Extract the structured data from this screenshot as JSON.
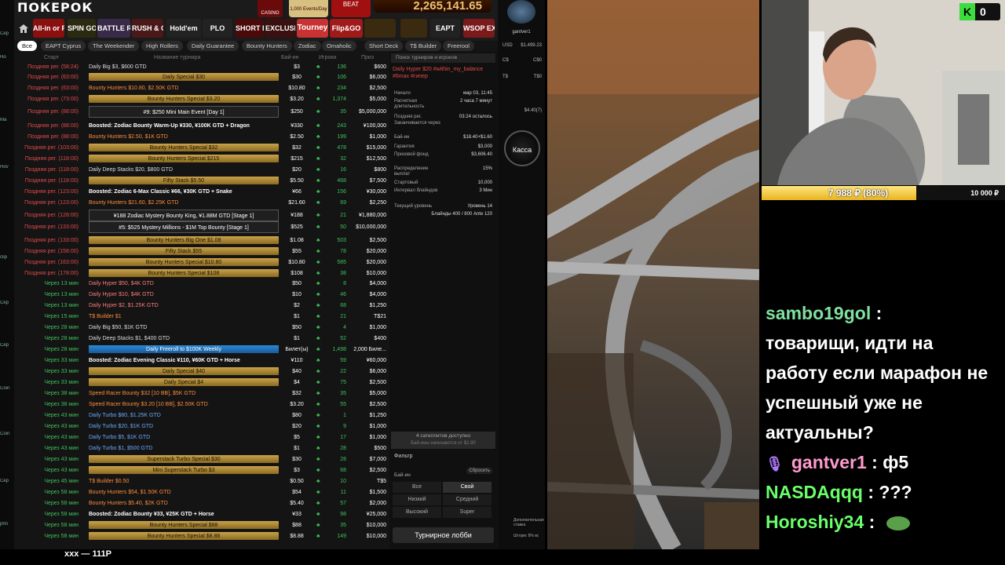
{
  "left_strip": [
    "Cер",
    "Ho",
    "Ma",
    "Hov",
    "clip",
    "Cер",
    "Cер",
    "Coin",
    "Coin",
    "Cер",
    "phn"
  ],
  "client": {
    "logo": "ПОКЕРОК",
    "promos": [
      "CASINO",
      "1,000 Events/Day",
      "BEAT"
    ],
    "jackpot": "2,265,141.65",
    "game_tabs": [
      "All-in or Fold",
      "SPIN GOLD",
      "BATTLE ROYALE",
      "RUSH & CASH",
      "Hold'em",
      "PLO",
      "SHORT DECK",
      "EXCLUSIVE",
      "Tourney",
      "Flip&GO",
      "",
      "",
      "EAPT",
      "WSOP EXPRESS"
    ],
    "filters": [
      "Все",
      "EAPT Cyprus",
      "The Weekender",
      "High Rollers",
      "Daily Guarantee",
      "Bounty Hunters",
      "Zodiac",
      "Omaholic",
      "Short Deck",
      "T$ Builder",
      "Freerool"
    ],
    "columns": {
      "start": "Старт",
      "name": "Название турнира",
      "buyin": "Бай-ин",
      "players": "Игроки",
      "prize": "Приз"
    },
    "rows": [
      {
        "s": "Поздняя рег. (58:24)",
        "n": "Daily Big $3, $600 GTD",
        "b": "$3",
        "p": "136",
        "z": "$600",
        "t": ""
      },
      {
        "s": "Поздняя рег. (63:00)",
        "n": "Daily Special $30",
        "b": "$30",
        "p": "106",
        "z": "$6,000",
        "t": "gold"
      },
      {
        "s": "Поздняя рег. (63:00)",
        "n": "Bounty Hunters $10.80, $2.50K GTD",
        "b": "$10.80",
        "p": "234",
        "z": "$2,500",
        "t": "bh"
      },
      {
        "s": "Поздняя рег. (73:00)",
        "n": "Bounty Hunters Special $3.20",
        "b": "$3.20",
        "p": "1,374",
        "z": "$5,000",
        "t": "gold"
      },
      {
        "s": "Поздняя рег. (88:00)",
        "n": "#9: $250 Mini Main Event [Day 1]",
        "b": "$250",
        "p": "35",
        "z": "$5,000,000",
        "t": "big"
      },
      {
        "s": "Поздняя рег. (88:00)",
        "n": "Boosted: Zodiac Bounty Warm-Up ¥330, ¥100K GTD + Dragon",
        "b": "¥330",
        "p": "243",
        "z": "¥100,000",
        "t": "white"
      },
      {
        "s": "Поздняя рег. (88:00)",
        "n": "Bounty Hunters $2.50, $1K GTD",
        "b": "$2.50",
        "p": "199",
        "z": "$1,000",
        "t": "bh"
      },
      {
        "s": "Поздняя рег. (103:00)",
        "n": "Bounty Hunters Special $32",
        "b": "$32",
        "p": "478",
        "z": "$15,000",
        "t": "gold"
      },
      {
        "s": "Поздняя рег. (118:00)",
        "n": "Bounty Hunters Special $215",
        "b": "$215",
        "p": "32",
        "z": "$12,500",
        "t": "gold"
      },
      {
        "s": "Поздняя рег. (118:00)",
        "n": "Daily Deep Stacks $20, $800 GTD",
        "b": "$20",
        "p": "16",
        "z": "$800",
        "t": ""
      },
      {
        "s": "Поздняя рег. (118:00)",
        "n": "Fifty Stack $5.50",
        "b": "$5.50",
        "p": "468",
        "z": "$7,500",
        "t": "gold"
      },
      {
        "s": "Поздняя рег. (123:00)",
        "n": "Boosted: Zodiac 6-Max Classic ¥66, ¥30K GTD + Snake",
        "b": "¥66",
        "p": "156",
        "z": "¥30,000",
        "t": "white"
      },
      {
        "s": "Поздняя рег. (123:00)",
        "n": "Bounty Hunters $21.60, $2.25K GTD",
        "b": "$21.60",
        "p": "69",
        "z": "$2,250",
        "t": "bh"
      },
      {
        "s": "Поздняя рег. (128:00)",
        "n": "¥188 Zodiac Mystery Bounty King, ¥1.88M GTD [Stage 1]",
        "b": "¥188",
        "p": "21",
        "z": "¥1,880,000",
        "t": "big"
      },
      {
        "s": "Поздняя рег. (133:00)",
        "n": "#5: $525 Mystery Millions - $1M Top Bounty [Stage 1]",
        "b": "$525",
        "p": "50",
        "z": "$10,000,000",
        "t": "big"
      },
      {
        "s": "Поздняя рег. (133:00)",
        "n": "Bounty Hunters Big One $1.08",
        "b": "$1.08",
        "p": "503",
        "z": "$2,500",
        "t": "gold"
      },
      {
        "s": "Поздняя рег. (158:00)",
        "n": "Fifty Stack $55",
        "b": "$55",
        "p": "78",
        "z": "$20,000",
        "t": "gold"
      },
      {
        "s": "Поздняя рег. (163:00)",
        "n": "Bounty Hunters Special $10.80",
        "b": "$10.80",
        "p": "585",
        "z": "$20,000",
        "t": "gold"
      },
      {
        "s": "Поздняя рег. (178:00)",
        "n": "Bounty Hunters Special $108",
        "b": "$108",
        "p": "38",
        "z": "$10,000",
        "t": "gold"
      },
      {
        "s": "Через 13 мин",
        "n": "Daily Hyper $50, $4K GTD",
        "b": "$50",
        "p": "8",
        "z": "$4,000",
        "t": "hyper"
      },
      {
        "s": "Через 13 мин",
        "n": "Daily Hyper $10, $4K GTD",
        "b": "$10",
        "p": "46",
        "z": "$4,000",
        "t": "hyper"
      },
      {
        "s": "Через 13 мин",
        "n": "Daily Hyper $2, $1.25K GTD",
        "b": "$2",
        "p": "68",
        "z": "$1,250",
        "t": "hyper"
      },
      {
        "s": "Через 15 мин",
        "n": "T$ Builder $1",
        "b": "$1",
        "p": "21",
        "z": "T$21",
        "t": "bh"
      },
      {
        "s": "Через 28 мин",
        "n": "Daily Big $50, $1K GTD",
        "b": "$50",
        "p": "4",
        "z": "$1,000",
        "t": ""
      },
      {
        "s": "Через 28 мин",
        "n": "Daily Deep Stacks $1, $400 GTD",
        "b": "$1",
        "p": "52",
        "z": "$400",
        "t": ""
      },
      {
        "s": "Через 28 мин",
        "n": "Daily Freeroll to $100K Weekly",
        "b": "Билет(ы)",
        "p": "1,498",
        "z": "2,000 Биле...",
        "t": "blue"
      },
      {
        "s": "Через 33 мин",
        "n": "Boosted: Zodiac Evening Classic ¥110, ¥60K GTD + Horse",
        "b": "¥110",
        "p": "59",
        "z": "¥60,000",
        "t": "white"
      },
      {
        "s": "Через 33 мин",
        "n": "Daily Special $40",
        "b": "$40",
        "p": "22",
        "z": "$6,000",
        "t": "gold"
      },
      {
        "s": "Через 33 мин",
        "n": "Daily Special $4",
        "b": "$4",
        "p": "75",
        "z": "$2,500",
        "t": "gold"
      },
      {
        "s": "Через 38 мин",
        "n": "Speed Racer Bounty $32 [10 BB], $5K GTD",
        "b": "$32",
        "p": "35",
        "z": "$5,000",
        "t": "bh"
      },
      {
        "s": "Через 38 мин",
        "n": "Speed Racer Bounty $3.20 [10 BB], $2.50K GTD",
        "b": "$3.20",
        "p": "55",
        "z": "$2,500",
        "t": "bh"
      },
      {
        "s": "Через 43 мин",
        "n": "Daily Turbo $80, $1.25K GTD",
        "b": "$80",
        "p": "1",
        "z": "$1,250",
        "t": "turbo"
      },
      {
        "s": "Через 43 мин",
        "n": "Daily Turbo $20, $1K GTD",
        "b": "$20",
        "p": "9",
        "z": "$1,000",
        "t": "turbo"
      },
      {
        "s": "Через 43 мин",
        "n": "Daily Turbo $5, $1K GTD",
        "b": "$5",
        "p": "17",
        "z": "$1,000",
        "t": "turbo"
      },
      {
        "s": "Через 43 мин",
        "n": "Daily Turbo $1, $500 GTD",
        "b": "$1",
        "p": "28",
        "z": "$500",
        "t": "turbo"
      },
      {
        "s": "Через 43 мин",
        "n": "Superstack Turbo Special $30",
        "b": "$30",
        "p": "28",
        "z": "$7,000",
        "t": "gold"
      },
      {
        "s": "Через 43 мин",
        "n": "Mini Superstack Turbo $3",
        "b": "$3",
        "p": "68",
        "z": "$2,500",
        "t": "gold"
      },
      {
        "s": "Через 45 мин",
        "n": "T$ Builder $0.50",
        "b": "$0.50",
        "p": "10",
        "z": "T$5",
        "t": "bh"
      },
      {
        "s": "Через 58 мин",
        "n": "Bounty Hunters $54, $1.50K GTD",
        "b": "$54",
        "p": "11",
        "z": "$1,500",
        "t": "bh"
      },
      {
        "s": "Через 58 мин",
        "n": "Bounty Hunters $5.40, $2K GTD",
        "b": "$5.40",
        "p": "57",
        "z": "$2,000",
        "t": "bh"
      },
      {
        "s": "Через 58 мин",
        "n": "Boosted: Zodiac Bounty ¥33, ¥25K GTD + Horse",
        "b": "¥33",
        "p": "98",
        "z": "¥25,000",
        "t": "white"
      },
      {
        "s": "Через 58 мин",
        "n": "Bounty Hunters Special $88",
        "b": "$88",
        "p": "35",
        "z": "$10,000",
        "t": "gold"
      },
      {
        "s": "Через 58 мин",
        "n": "Bounty Hunters Special $8.88",
        "b": "$8.88",
        "p": "149",
        "z": "$10,000",
        "t": "gold"
      }
    ],
    "detail": {
      "search": "Поиск турниров и игроков",
      "title": "Daily Hyper $20 #within_my_balance #6max #гипер",
      "fields": [
        [
          "Начало",
          "мар 03, 11:45"
        ],
        [
          "Расчетная длительность",
          "2 часа 7 минут"
        ],
        [
          "Поздняя рег.",
          "03:24 осталось"
        ],
        [
          "Заканчивается через",
          ""
        ],
        [
          "Бай-ин",
          "$18.40+$1.60"
        ],
        [
          "Гарантия",
          "$3,000"
        ],
        [
          "Призовой фонд",
          "$3,606.40"
        ],
        [
          "Распределение выплат",
          "15%"
        ],
        [
          "Стартовый",
          "10,000"
        ],
        [
          "Интервал блайндов",
          "3 Мин"
        ],
        [
          "Текущий уровень",
          "Уровень 14"
        ],
        [
          "",
          "Блайнды 400 / 800 Ante 120"
        ]
      ],
      "satellites": "4 сателлитов доступно",
      "satellites_sub": "Бай-ины начинаются от $2.80",
      "filter_title": "Фильтр",
      "buyin_label": "Бай-ин",
      "reset": "Сбросить",
      "filter_buttons": [
        "Все",
        "Свой",
        "Низкий",
        "Средний",
        "Высокий",
        "Super"
      ],
      "lobby": "Турнирное лобби"
    },
    "right": {
      "username": "gantver1",
      "currencies": [
        [
          "USD",
          "$1,499.23"
        ],
        [
          "C$",
          "C$0"
        ],
        [
          "T$",
          "T$0"
        ],
        [
          "",
          ""
        ],
        [
          "",
          "$4.40(7)"
        ]
      ],
      "cashier": "Касса",
      "bottom_notes": [
        "Дополнительная ставка",
        "Шторм: 8% вс"
      ]
    }
  },
  "stream": {
    "kick_count": "0",
    "donation_text": "7 988 ₽ (80%)",
    "donation_goal": "10 000 ₽",
    "donation_progress": 0.8,
    "bottom": "xxx — 111Р",
    "chat": [
      {
        "user": "sambo19gol",
        "sep": " :",
        "text": ""
      },
      {
        "user": "",
        "sep": "",
        "text": "товарищи, идти на"
      },
      {
        "user": "",
        "sep": "",
        "text": "работу если марафон не"
      },
      {
        "user": "",
        "sep": "",
        "text": "успешный уже не"
      },
      {
        "user": "",
        "sep": "",
        "text": "актуальны?"
      },
      {
        "user": "gantver1",
        "sep": " : ",
        "text": "ф5"
      },
      {
        "user": "NASDAqqq",
        "sep": " : ",
        "text": "???"
      },
      {
        "user": "Horoshiy34",
        "sep": " : ",
        "text": ""
      }
    ]
  }
}
